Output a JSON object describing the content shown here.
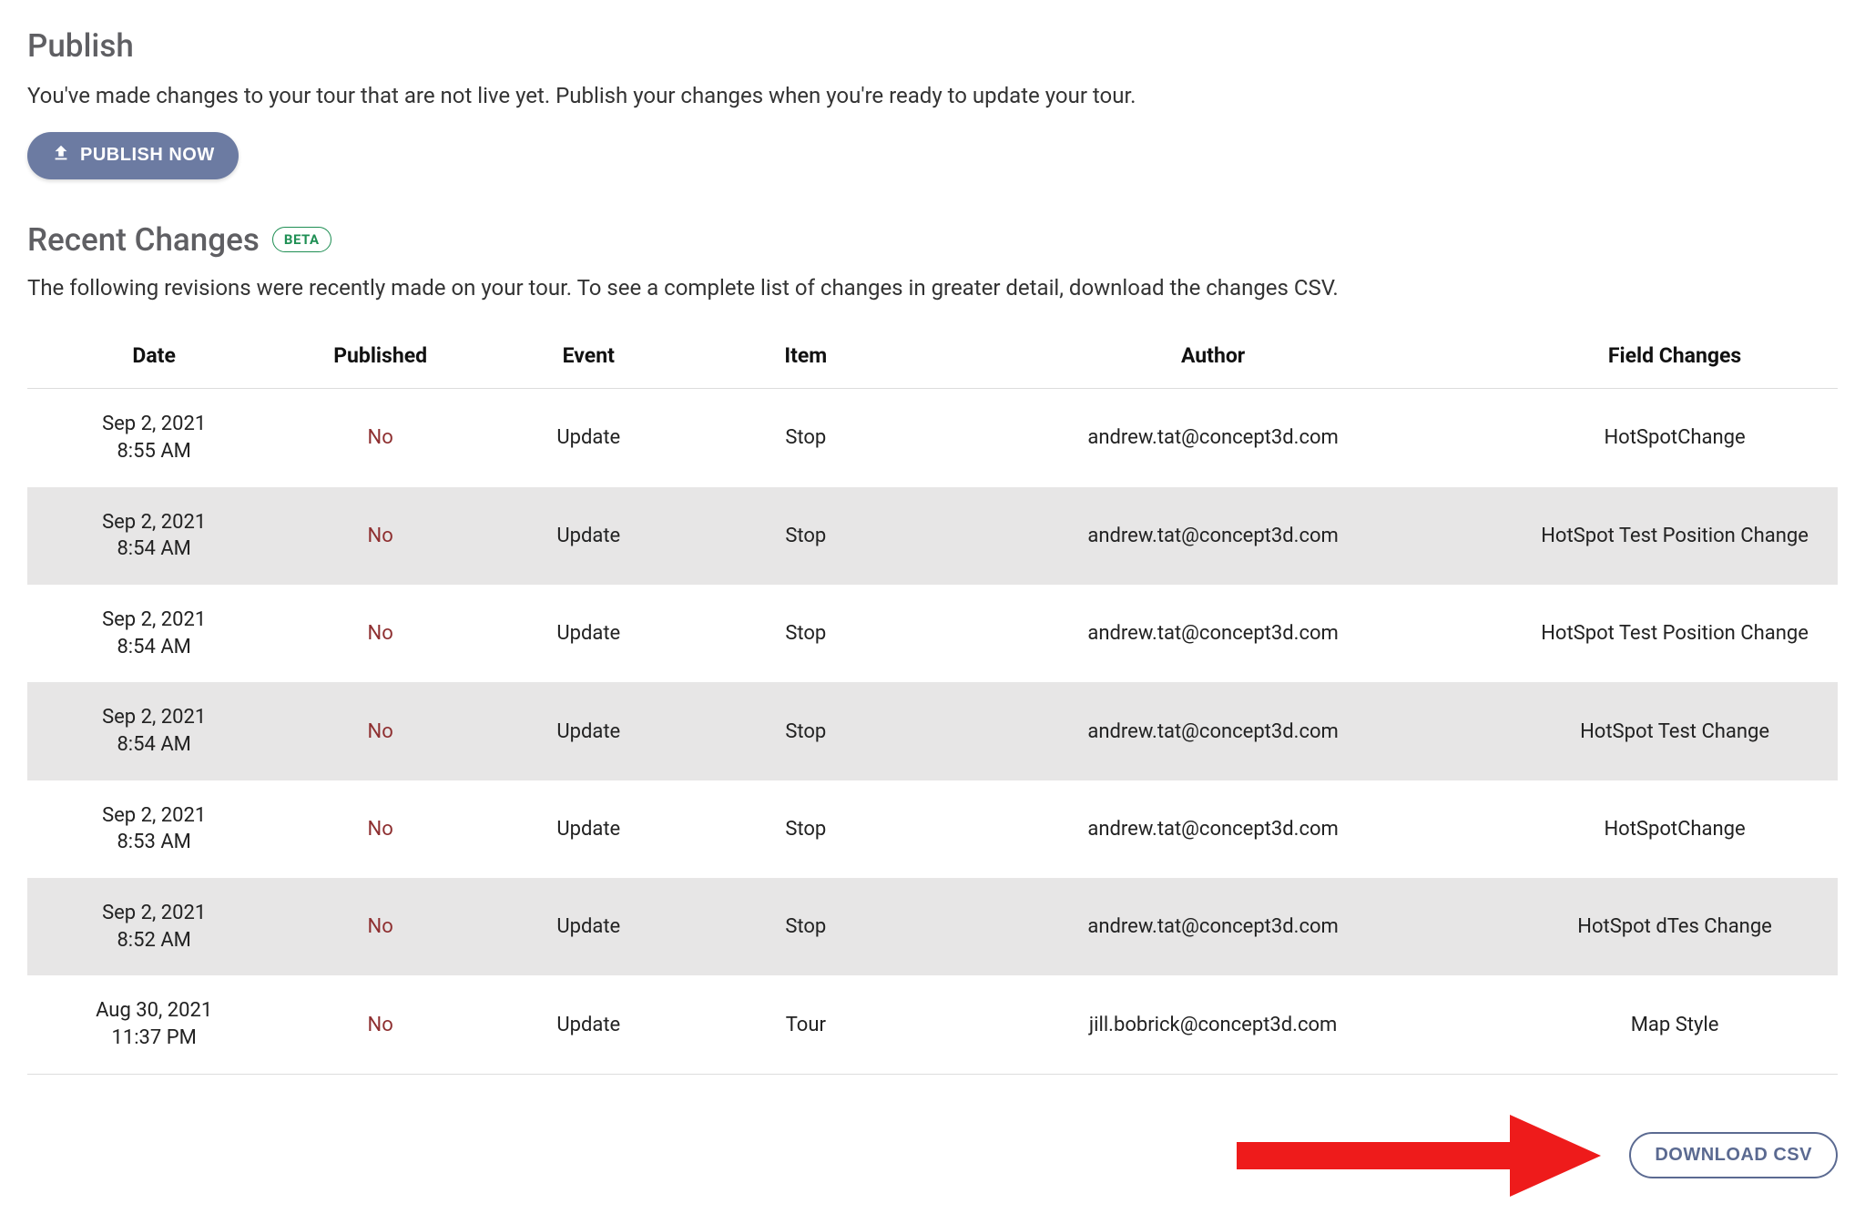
{
  "publish": {
    "title": "Publish",
    "description": "You've made changes to your tour that are not live yet. Publish your changes when you're ready to update your tour.",
    "button_label": "PUBLISH NOW"
  },
  "recent": {
    "title": "Recent Changes",
    "badge": "BETA",
    "description": "The following revisions were recently made on your tour. To see a complete list of changes in greater detail, download the changes CSV.",
    "download_label": "DOWNLOAD CSV",
    "columns": {
      "date": "Date",
      "published": "Published",
      "event": "Event",
      "item": "Item",
      "author": "Author",
      "field_changes": "Field Changes"
    },
    "rows": [
      {
        "date": "Sep 2, 2021",
        "time": "8:55 AM",
        "published": "No",
        "event": "Update",
        "item": "Stop",
        "author": "andrew.tat@concept3d.com",
        "field_changes": "HotSpotChange"
      },
      {
        "date": "Sep 2, 2021",
        "time": "8:54 AM",
        "published": "No",
        "event": "Update",
        "item": "Stop",
        "author": "andrew.tat@concept3d.com",
        "field_changes": "HotSpot Test Position Change"
      },
      {
        "date": "Sep 2, 2021",
        "time": "8:54 AM",
        "published": "No",
        "event": "Update",
        "item": "Stop",
        "author": "andrew.tat@concept3d.com",
        "field_changes": "HotSpot Test Position Change"
      },
      {
        "date": "Sep 2, 2021",
        "time": "8:54 AM",
        "published": "No",
        "event": "Update",
        "item": "Stop",
        "author": "andrew.tat@concept3d.com",
        "field_changes": "HotSpot Test Change"
      },
      {
        "date": "Sep 2, 2021",
        "time": "8:53 AM",
        "published": "No",
        "event": "Update",
        "item": "Stop",
        "author": "andrew.tat@concept3d.com",
        "field_changes": "HotSpotChange"
      },
      {
        "date": "Sep 2, 2021",
        "time": "8:52 AM",
        "published": "No",
        "event": "Update",
        "item": "Stop",
        "author": "andrew.tat@concept3d.com",
        "field_changes": "HotSpot dTes Change"
      },
      {
        "date": "Aug 30, 2021",
        "time": "11:37 PM",
        "published": "No",
        "event": "Update",
        "item": "Tour",
        "author": "jill.bobrick@concept3d.com",
        "field_changes": "Map Style"
      }
    ]
  },
  "colors": {
    "accent": "#6c7ba2",
    "published_no": "#8e2f30",
    "beta": "#1f8f54",
    "annotation_arrow": "#ee1b1b"
  }
}
